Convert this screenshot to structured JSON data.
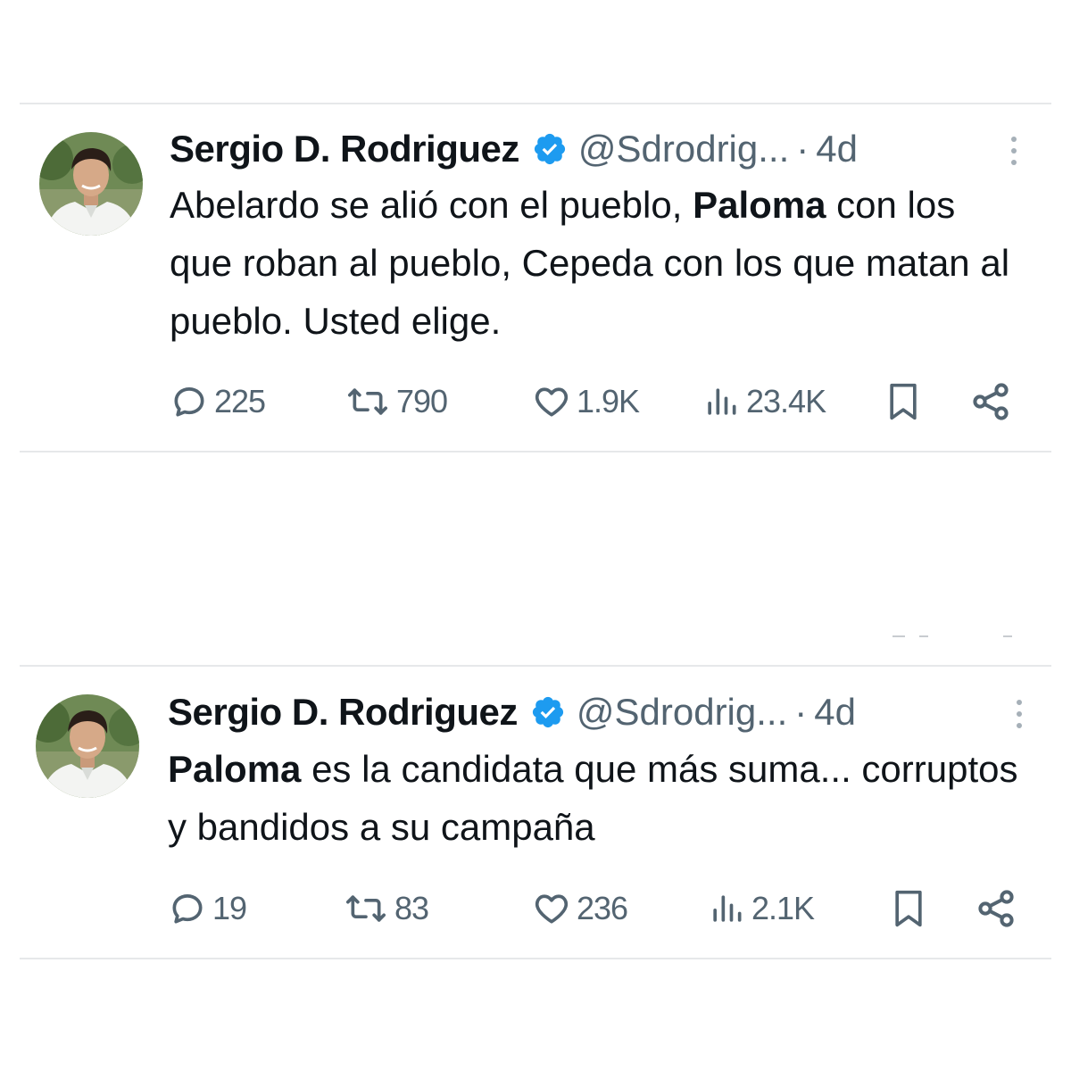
{
  "tweets": [
    {
      "author_name": "Sergio D. Rodriguez",
      "handle": "@Sdrodrig...",
      "separator": "·",
      "time": "4d",
      "text_parts": [
        {
          "t": "Abelardo se alió con el pueblo, ",
          "bold": false
        },
        {
          "t": "Paloma",
          "bold": true
        },
        {
          "t": " con los que roban al pueblo, Cepeda con los que matan al pueblo. Usted elige.",
          "bold": false
        }
      ],
      "stats": {
        "replies": "225",
        "reposts": "790",
        "likes": "1.9K",
        "views": "23.4K"
      }
    },
    {
      "author_name": "Sergio D. Rodriguez",
      "handle": "@Sdrodrig...",
      "separator": "·",
      "time": "4d",
      "text_parts": [
        {
          "t": "Paloma",
          "bold": true
        },
        {
          "t": " es la candidata que más suma... corruptos y bandidos a su campaña",
          "bold": false
        }
      ],
      "stats": {
        "replies": "19",
        "reposts": "83",
        "likes": "236",
        "views": "2.1K"
      }
    }
  ],
  "colors": {
    "verified_blue": "#1d9bf0",
    "secondary_text": "#536471",
    "divider": "#e6e8ea"
  },
  "icons": [
    "verified-badge-icon",
    "more-options-icon",
    "reply-icon",
    "repost-icon",
    "like-icon",
    "views-icon",
    "bookmark-icon",
    "share-icon"
  ]
}
